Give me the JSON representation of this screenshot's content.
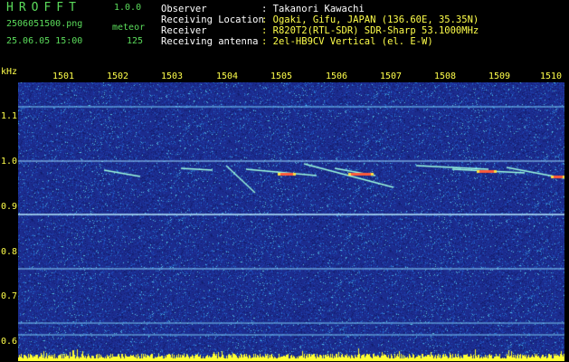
{
  "header": {
    "brand": "HROFFT",
    "version": "1.0.0",
    "filename": "2506051500.png",
    "datetime": "25.06.05 15:00",
    "mode": "meteor",
    "count": "125",
    "fields": [
      {
        "label": "Observer",
        "value": ": Takanori Kawachi"
      },
      {
        "label": "Receiving Location",
        "value": ": Ogaki, Gifu, JAPAN (136.60E, 35.35N)"
      },
      {
        "label": "Receiver",
        "value": ": R820T2(RTL-SDR) SDR-Sharp 53.1000MHz"
      },
      {
        "label": "Receiving antenna",
        "value": ": 2el-HB9CV Vertical (el. E-W)"
      }
    ]
  },
  "axes": {
    "y_unit": "kHz",
    "x_ticks": [
      "1501",
      "1502",
      "1503",
      "1504",
      "1505",
      "1506",
      "1507",
      "1508",
      "1509",
      "1510"
    ],
    "y_ticks": [
      "1.1",
      "1.0",
      "0.9",
      "0.8",
      "0.7",
      "0.6"
    ]
  },
  "colors": {
    "background": "#1c2c8e",
    "header_label": "#ffffff",
    "header_value": "#ffff4a",
    "brand": "#5bdc5b"
  }
}
